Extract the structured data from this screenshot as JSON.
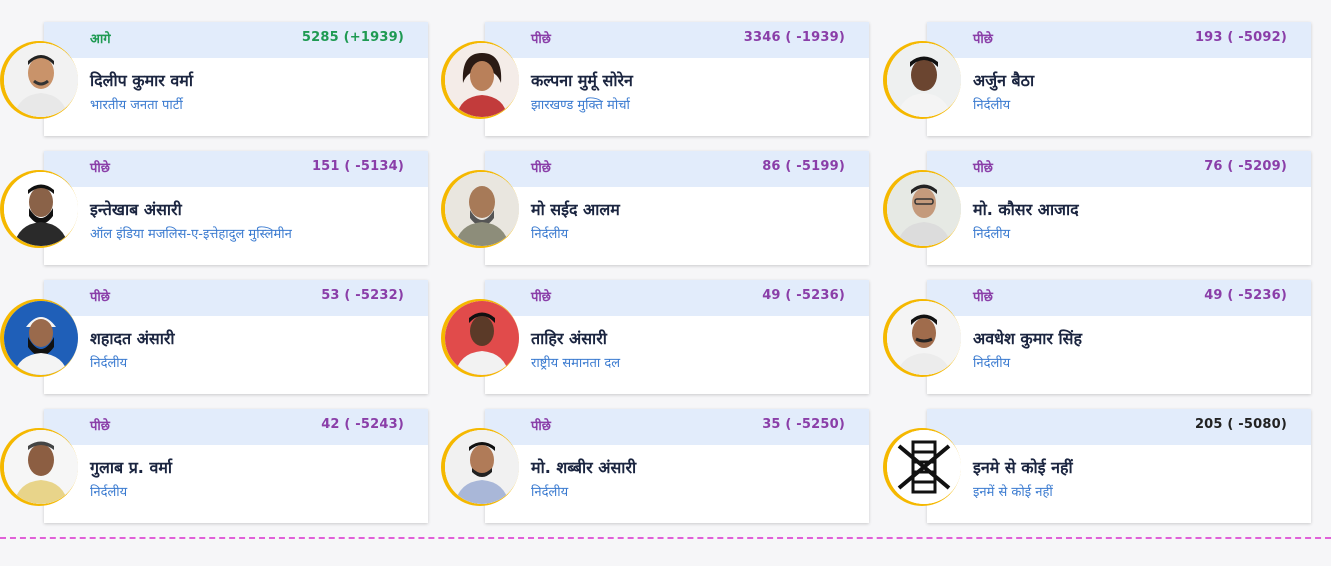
{
  "colors": {
    "accent_ring": "#f5b800",
    "header_bg": "#e2ecfb",
    "status_lead": "#1e9a52",
    "status_trail": "#8a3ea8",
    "party_text": "#3b7bd0",
    "divider": "#e060d8"
  },
  "candidates": [
    {
      "status": "आगे",
      "votes": "5285 (+1939)",
      "name": "दिलीप कुमार वर्मा",
      "party": "भारतीय जनता पार्टी",
      "photo_icon": "candidate-photo-icon"
    },
    {
      "status": "पीछे",
      "votes": "3346 ( -1939)",
      "name": "कल्पना मुर्मू सोरेन",
      "party": "झारखण्ड मुक्ति मोर्चा",
      "photo_icon": "candidate-photo-icon"
    },
    {
      "status": "पीछे",
      "votes": "193 ( -5092)",
      "name": "अर्जुन बैठा",
      "party": "निर्दलीय",
      "photo_icon": "candidate-photo-icon"
    },
    {
      "status": "पीछे",
      "votes": "151 ( -5134)",
      "name": "इन्तेखाब अंसारी",
      "party": "ऑल इंडिया मजलिस-ए-इत्तेहादुल मुस्लिमीन",
      "photo_icon": "candidate-photo-icon"
    },
    {
      "status": "पीछे",
      "votes": "86 ( -5199)",
      "name": "मो सईद आलम",
      "party": "निर्दलीय",
      "photo_icon": "candidate-photo-icon"
    },
    {
      "status": "पीछे",
      "votes": "76 ( -5209)",
      "name": "मो. कौसर आजाद",
      "party": "निर्दलीय",
      "photo_icon": "candidate-photo-icon"
    },
    {
      "status": "पीछे",
      "votes": "53 ( -5232)",
      "name": "शहादत अंसारी",
      "party": "निर्दलीय",
      "photo_icon": "candidate-photo-icon"
    },
    {
      "status": "पीछे",
      "votes": "49 ( -5236)",
      "name": "ताहिर अंसारी",
      "party": "राष्ट्रीय समानता दल",
      "photo_icon": "candidate-photo-icon"
    },
    {
      "status": "पीछे",
      "votes": "49 ( -5236)",
      "name": "अवधेश कुमार सिंह",
      "party": "निर्दलीय",
      "photo_icon": "candidate-photo-icon"
    },
    {
      "status": "पीछे",
      "votes": "42 ( -5243)",
      "name": "गुलाब प्र. वर्मा",
      "party": "निर्दलीय",
      "photo_icon": "candidate-photo-icon"
    },
    {
      "status": "पीछे",
      "votes": "35 ( -5250)",
      "name": "मो. शब्बीर अंसारी",
      "party": "निर्दलीय",
      "photo_icon": "candidate-photo-icon"
    },
    {
      "status": "",
      "votes": "205 ( -5080)",
      "name": "इनमे से कोई नहीं",
      "party": "इनमें से कोई नहीं",
      "photo_icon": "nota-icon"
    }
  ]
}
